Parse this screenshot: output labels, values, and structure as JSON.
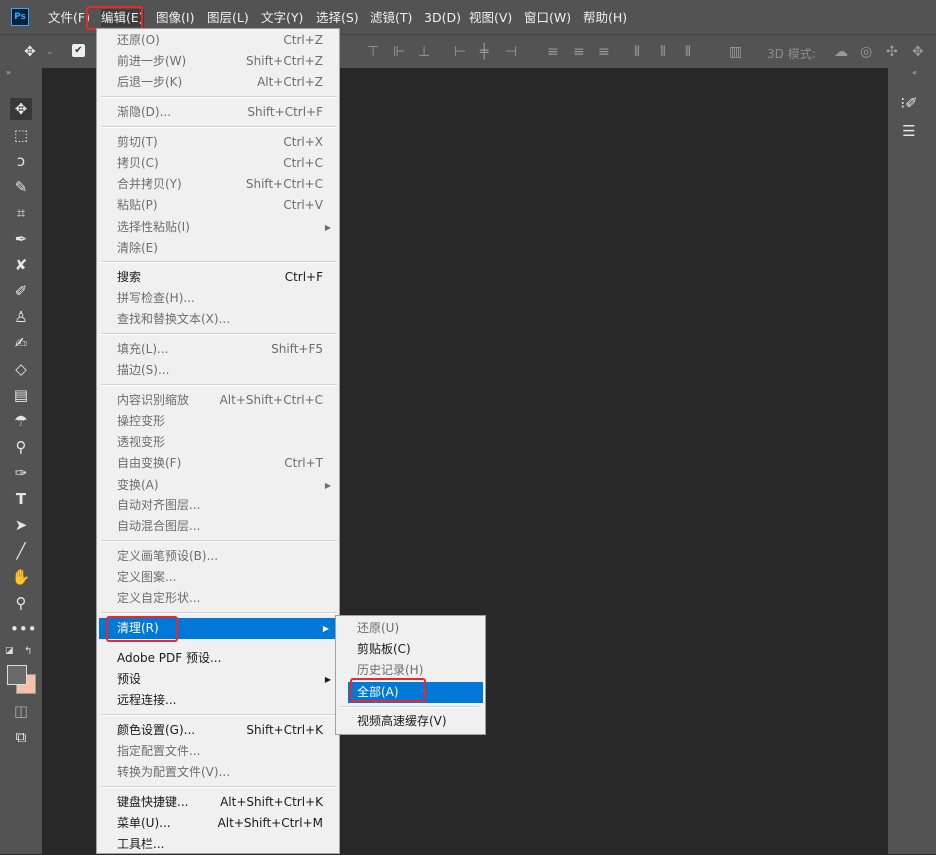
{
  "app": {
    "logo_text": "Ps"
  },
  "menubar": {
    "items": [
      {
        "label": "文件(F)"
      },
      {
        "label": "编辑(E)"
      },
      {
        "label": "图像(I)"
      },
      {
        "label": "图层(L)"
      },
      {
        "label": "文字(Y)"
      },
      {
        "label": "选择(S)"
      },
      {
        "label": "滤镜(T)"
      },
      {
        "label": "3D(D)"
      },
      {
        "label": "视图(V)"
      },
      {
        "label": "窗口(W)"
      },
      {
        "label": "帮助(H)"
      }
    ]
  },
  "options_bar": {
    "mode_3d_label": "3D 模式:"
  },
  "edit_menu": {
    "items": [
      {
        "label": "还原(O)",
        "shortcut": "Ctrl+Z"
      },
      {
        "label": "前进一步(W)",
        "shortcut": "Shift+Ctrl+Z"
      },
      {
        "label": "后退一步(K)",
        "shortcut": "Alt+Ctrl+Z"
      },
      {
        "label": "渐隐(D)...",
        "shortcut": "Shift+Ctrl+F"
      },
      {
        "label": "剪切(T)",
        "shortcut": "Ctrl+X"
      },
      {
        "label": "拷贝(C)",
        "shortcut": "Ctrl+C"
      },
      {
        "label": "合并拷贝(Y)",
        "shortcut": "Shift+Ctrl+C"
      },
      {
        "label": "粘贴(P)",
        "shortcut": "Ctrl+V"
      },
      {
        "label": "选择性粘贴(I)",
        "shortcut": ""
      },
      {
        "label": "清除(E)",
        "shortcut": ""
      },
      {
        "label": "搜索",
        "shortcut": "Ctrl+F"
      },
      {
        "label": "拼写检查(H)...",
        "shortcut": ""
      },
      {
        "label": "查找和替换文本(X)...",
        "shortcut": ""
      },
      {
        "label": "填充(L)...",
        "shortcut": "Shift+F5"
      },
      {
        "label": "描边(S)...",
        "shortcut": ""
      },
      {
        "label": "内容识别缩放",
        "shortcut": "Alt+Shift+Ctrl+C"
      },
      {
        "label": "操控变形",
        "shortcut": ""
      },
      {
        "label": "透视变形",
        "shortcut": ""
      },
      {
        "label": "自由变换(F)",
        "shortcut": "Ctrl+T"
      },
      {
        "label": "变换(A)",
        "shortcut": ""
      },
      {
        "label": "自动对齐图层...",
        "shortcut": ""
      },
      {
        "label": "自动混合图层...",
        "shortcut": ""
      },
      {
        "label": "定义画笔预设(B)...",
        "shortcut": ""
      },
      {
        "label": "定义图案...",
        "shortcut": ""
      },
      {
        "label": "定义自定形状...",
        "shortcut": ""
      },
      {
        "label": "清理(R)",
        "shortcut": ""
      },
      {
        "label": "Adobe PDF 预设...",
        "shortcut": ""
      },
      {
        "label": "预设",
        "shortcut": ""
      },
      {
        "label": "远程连接...",
        "shortcut": ""
      },
      {
        "label": "颜色设置(G)...",
        "shortcut": "Shift+Ctrl+K"
      },
      {
        "label": "指定配置文件...",
        "shortcut": ""
      },
      {
        "label": "转换为配置文件(V)...",
        "shortcut": ""
      },
      {
        "label": "键盘快捷键...",
        "shortcut": "Alt+Shift+Ctrl+K"
      },
      {
        "label": "菜单(U)...",
        "shortcut": "Alt+Shift+Ctrl+M"
      },
      {
        "label": "工具栏...",
        "shortcut": ""
      }
    ]
  },
  "purge_submenu": {
    "items": [
      {
        "label": "还原(U)"
      },
      {
        "label": "剪贴板(C)"
      },
      {
        "label": "历史记录(H)"
      },
      {
        "label": "全部(A)"
      },
      {
        "label": "视频高速缓存(V)"
      }
    ]
  }
}
